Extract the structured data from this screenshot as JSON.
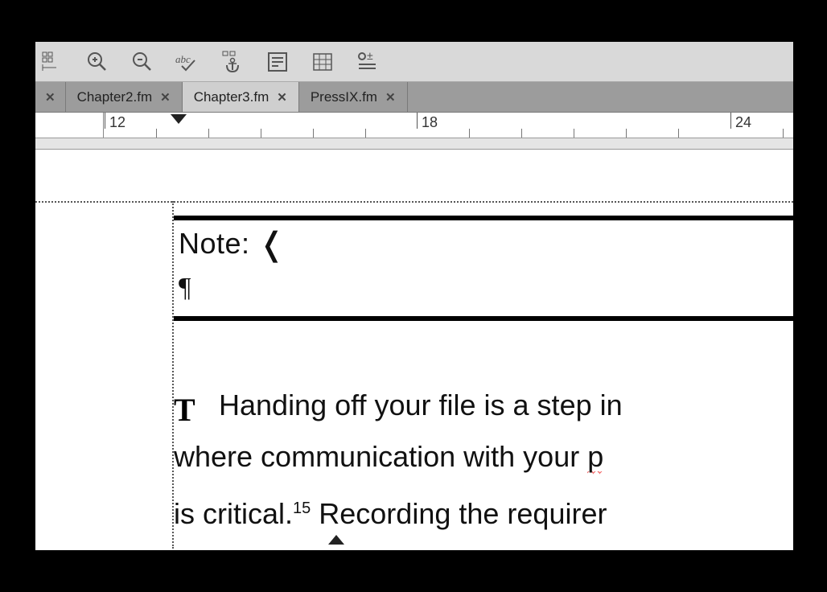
{
  "tabs": {
    "t0_label": "",
    "t1_label": "Chapter2.fm",
    "t2_label": "Chapter3.fm",
    "t3_label": "PressIX.fm"
  },
  "ruler": {
    "label_12": "12",
    "label_18": "18",
    "label_24": "24"
  },
  "document": {
    "note_label": "Note:",
    "para_mark": "¶",
    "body_line1": "Handing off your file is a step in",
    "body_line2a": "where communication with your ",
    "body_line2b": "p",
    "body_line3a": "is critical.",
    "body_line3_sup": "15",
    "body_line3b": " Recording the requirer"
  }
}
